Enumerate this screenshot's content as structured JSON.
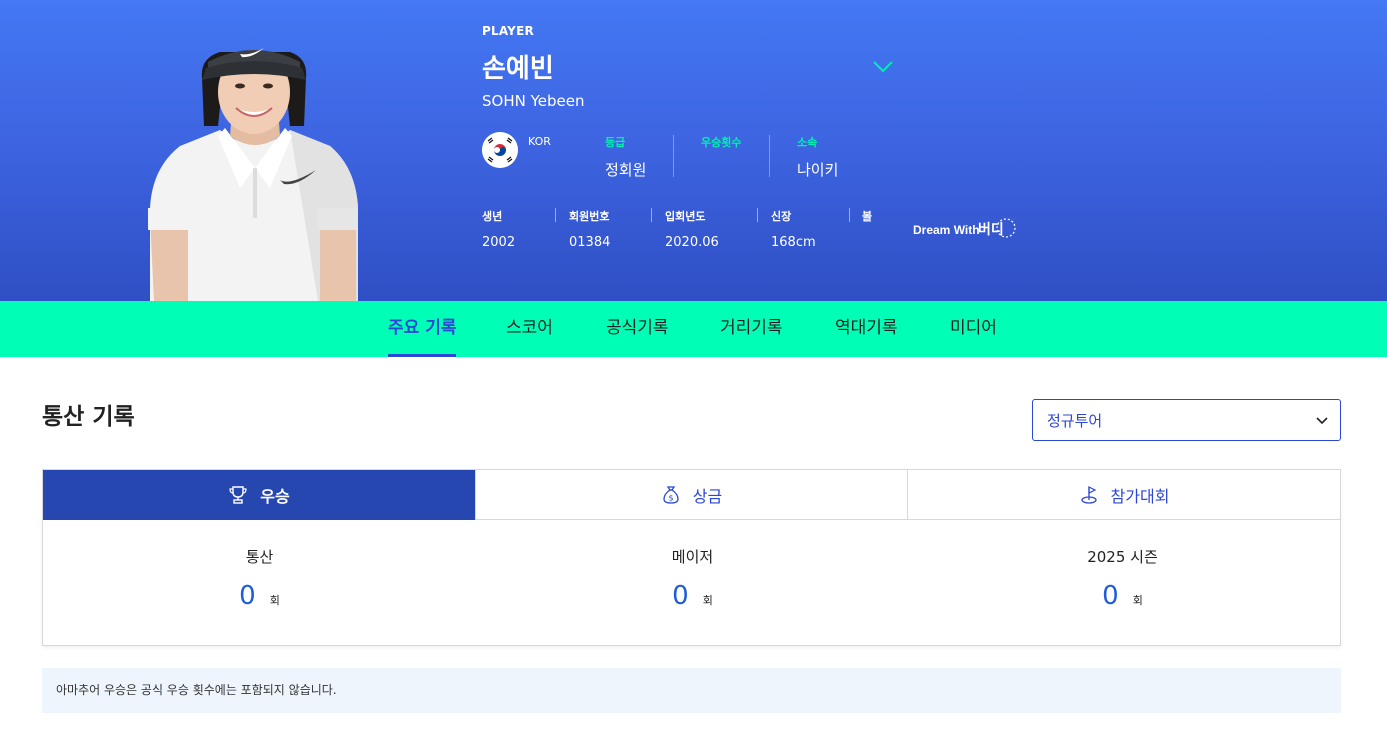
{
  "header": {
    "player_label": "PLAYER",
    "name_ko": "손예빈",
    "name_en": "SOHN Yebeen",
    "nation": "KOR",
    "grade_label": "등급",
    "grade_value": "정회원",
    "wins_label": "우승횟수",
    "wins_value": "",
    "affiliation_label": "소속",
    "affiliation_value": "나이키",
    "stats": [
      {
        "label": "생년",
        "value": "2002"
      },
      {
        "label": "회원번호",
        "value": "01384"
      },
      {
        "label": "입회년도",
        "value": "2020.06"
      },
      {
        "label": "신장",
        "value": "168cm"
      },
      {
        "label": "볼",
        "value": ""
      }
    ],
    "sponsor_text": "Dream With",
    "sponsor_brand": "버디"
  },
  "tabs": [
    {
      "label": "주요 기록",
      "active": true
    },
    {
      "label": "스코어"
    },
    {
      "label": "공식기록"
    },
    {
      "label": "거리기록"
    },
    {
      "label": "역대기록"
    },
    {
      "label": "미디어"
    }
  ],
  "content": {
    "section_title": "통산 기록",
    "tour_select": "정규투어",
    "record_tabs": [
      {
        "label": "우승",
        "icon": "trophy-icon",
        "active": true
      },
      {
        "label": "상금",
        "icon": "money-bag-icon"
      },
      {
        "label": "참가대회",
        "icon": "golf-flag-icon"
      }
    ],
    "metrics": [
      {
        "label": "통산",
        "value": "0",
        "unit": "회"
      },
      {
        "label": "메이저",
        "value": "0",
        "unit": "회"
      },
      {
        "label": "2025 시즌",
        "value": "0",
        "unit": "회"
      }
    ],
    "notice": "아마추어 우승은 공식 우승 횟수에는 포함되지 않습니다."
  },
  "colors": {
    "hero_top": "#4478f4",
    "hero_bottom": "#2f4fc4",
    "tabbar": "#00ffb6",
    "accent": "#2b47d6",
    "active_record_tab": "#2646b0",
    "number": "#1f5dd8",
    "label_accent": "#00f0b0"
  }
}
